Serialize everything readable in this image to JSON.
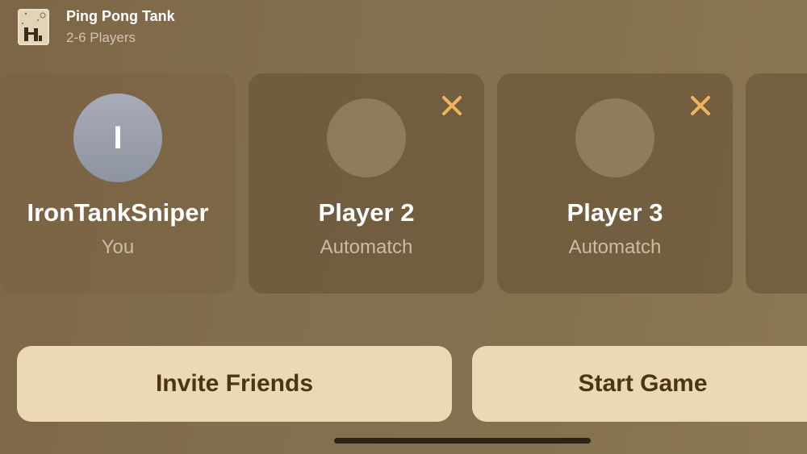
{
  "app": {
    "title": "Ping Pong Tank",
    "subtitle": "2-6 Players",
    "icon": "ping-pong-tank-app-icon"
  },
  "players": [
    {
      "name": "IronTankSniper",
      "status": "You",
      "avatar_initial": "I",
      "removable": false
    },
    {
      "name": "Player 2",
      "status": "Automatch",
      "removable": true
    },
    {
      "name": "Player 3",
      "status": "Automatch",
      "removable": true
    }
  ],
  "actions": {
    "invite_label": "Invite Friends",
    "start_label": "Start Game"
  },
  "colors": {
    "accent_x": "#f0b55a",
    "button_bg": "#ecd8b4",
    "button_text": "#4b3514"
  }
}
